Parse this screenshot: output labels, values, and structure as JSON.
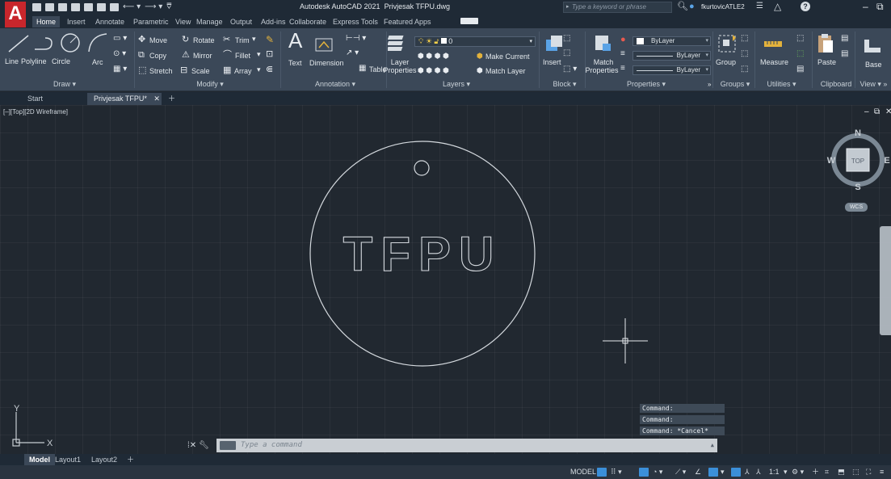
{
  "app": {
    "logo": "A",
    "title": "Autodesk AutoCAD 2021",
    "filename": "Privjesak TFPU.dwg",
    "search_placeholder": "Type a keyword or phrase",
    "user": "fkurtovicATLE2"
  },
  "ribbon_tabs": [
    "Home",
    "Insert",
    "Annotate",
    "Parametric",
    "View",
    "Manage",
    "Output",
    "Add-ins",
    "Collaborate",
    "Express Tools",
    "Featured Apps"
  ],
  "draw": {
    "title": "Draw",
    "tools": [
      "Line",
      "Polyline",
      "Circle",
      "Arc"
    ]
  },
  "modify": {
    "title": "Modify",
    "move": "Move",
    "rotate": "Rotate",
    "trim": "Trim",
    "copy": "Copy",
    "mirror": "Mirror",
    "fillet": "Fillet",
    "stretch": "Stretch",
    "scale": "Scale",
    "array": "Array"
  },
  "annotation": {
    "title": "Annotation",
    "text": "Text",
    "dimension": "Dimension",
    "table": "Table"
  },
  "layers": {
    "title": "Layers",
    "layer_properties_1": "Layer",
    "layer_properties_2": "Properties",
    "current_layer": "0",
    "make_current": "Make Current",
    "match_layer": "Match Layer"
  },
  "block": {
    "title": "Block",
    "insert": "Insert"
  },
  "properties": {
    "title": "Properties",
    "match_1": "Match",
    "match_2": "Properties",
    "color": "ByLayer",
    "linetype": "ByLayer",
    "lineweight": "ByLayer"
  },
  "groups": {
    "title": "Groups",
    "group": "Group"
  },
  "utilities": {
    "title": "Utilities",
    "measure": "Measure"
  },
  "clipboard": {
    "title": "Clipboard",
    "paste": "Paste"
  },
  "view_panel": {
    "title": "View",
    "base": "Base"
  },
  "file_tabs": [
    "Start",
    "Privjesak TFPU*"
  ],
  "viewport_label": "[–][Top][2D Wireframe]",
  "viewcube": {
    "top": "TOP",
    "n": "N",
    "s": "S",
    "e": "E",
    "w": "W",
    "wcs": "WCS"
  },
  "drawing": {
    "text": "TFPU"
  },
  "ucs": {
    "x": "X",
    "y": "Y"
  },
  "command_history": [
    "Command:",
    "Command:",
    "Command: *Cancel*"
  ],
  "command_placeholder": "Type a command",
  "layout_tabs": [
    "Model",
    "Layout1",
    "Layout2"
  ],
  "status": {
    "model": "MODEL",
    "scale": "1:1"
  },
  "colors": {
    "accent": "#3b8fd9",
    "logo": "#c8262c",
    "background": "#212830"
  }
}
